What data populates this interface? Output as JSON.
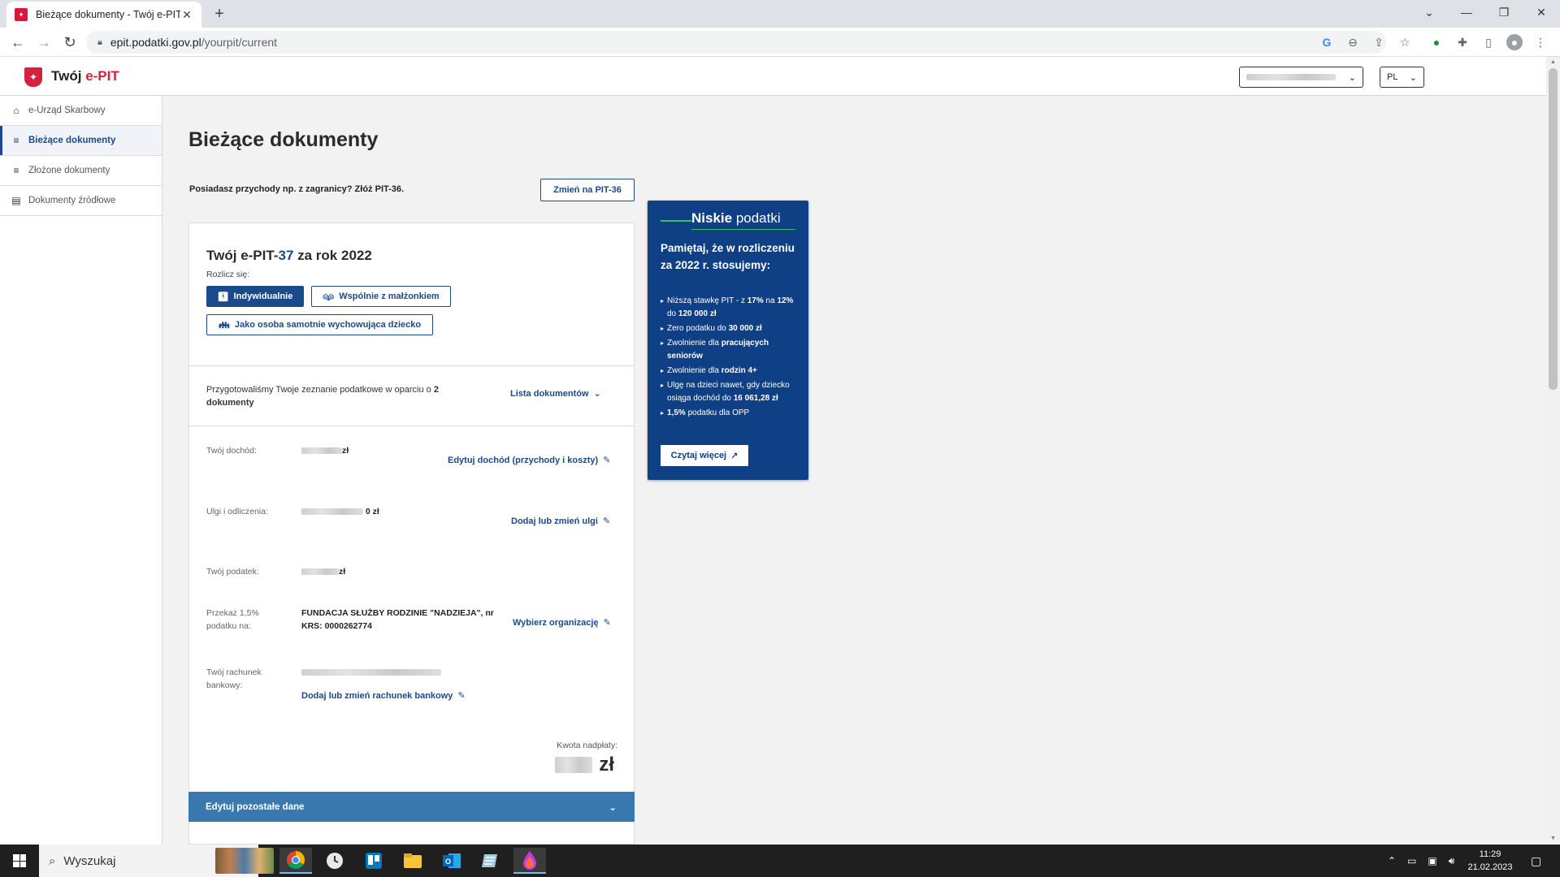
{
  "browser": {
    "tab_title": "Bieżące dokumenty - Twój e-PIT",
    "url_host": "epit.podatki.gov.pl",
    "url_path": "/yourpit/current"
  },
  "header": {
    "logo_prefix": "Twój ",
    "logo_accent": "e-PIT",
    "language": "PL"
  },
  "sidebar": {
    "items": [
      {
        "label": "e-Urząd Skarbowy",
        "icon": "home-icon",
        "active": false
      },
      {
        "label": "Bieżące dokumenty",
        "icon": "list-edit-icon",
        "active": true
      },
      {
        "label": "Złożone dokumenty",
        "icon": "list-check-icon",
        "active": false
      },
      {
        "label": "Dokumenty źródłowe",
        "icon": "document-icon",
        "active": false
      }
    ]
  },
  "main": {
    "title": "Bieżące dokumenty",
    "promo_text": "Posiadasz przychody np. z zagranicy? Złóż PIT-36.",
    "change_button": "Zmień na PIT-36",
    "card": {
      "title_prefix": "Twój ",
      "title_accent_1": "e-PIT-",
      "title_accent_2": "37",
      "title_suffix": " za rok 2022",
      "settle_label": "Rozlicz się:",
      "options": {
        "individual": "Indywidualnie",
        "spouse": "Wspólnie z małżonkiem",
        "single_parent": "Jako osoba samotnie wychowująca dziecko"
      },
      "prepared_text": "Przygotowaliśmy Twoje zeznanie podatkowe w oparciu o ",
      "prepared_bold": "2 dokumenty",
      "documents_link": "Lista dokumentów",
      "income_label": "Twój dochód:",
      "income_unit": "zł",
      "income_link": "Edytuj dochód (przychody i koszty)",
      "relief_label": "Ulgi i odliczenia:",
      "relief_value": "0 zł",
      "relief_link": "Dodaj lub zmień ulgi",
      "tax_label": "Twój podatek:",
      "tax_unit": "zł",
      "donation_label": "Przekaż 1,5% podatku na:",
      "donation_value": "FUNDACJA SŁUŻBY RODZINIE \"NADZIEJA\", nr KRS: 0000262774",
      "donation_link": "Wybierz organizację",
      "bank_label": "Twój rachunek bankowy:",
      "bank_link": "Dodaj lub zmień rachunek bankowy",
      "refund_label": "Kwota nadpłaty:",
      "refund_unit": "zł",
      "accordion": "Edytuj pozostałe dane"
    }
  },
  "promo_box": {
    "logo_bold": "Niskie",
    "logo_light": " podatki",
    "heading": "Pamiętaj, że w rozliczeniu za 2022 r. stosujemy:",
    "item1_a": "Niższą stawkę PIT - z ",
    "item1_b": "17%",
    "item1_c": " na ",
    "item1_d": "12%",
    "item1_e": " do ",
    "item1_f": "120 000 zł",
    "item2_a": "Zero podatku do ",
    "item2_b": "30 000 zł",
    "item3_a": "Zwolnienie dla ",
    "item3_b": "pracujących seniorów",
    "item4_a": "Zwolnienie dla ",
    "item4_b": "rodzin 4+",
    "item5_a": "Ulgę na dzieci nawet, gdy dziecko osiąga dochód do ",
    "item5_b": "16 061,28 zł",
    "item6_a": "1,5%",
    "item6_b": " podatku dla OPP",
    "button": "Czytaj więcej"
  },
  "taskbar": {
    "search": "Wyszukaj",
    "time": "11:29",
    "date": "21.02.2023"
  }
}
